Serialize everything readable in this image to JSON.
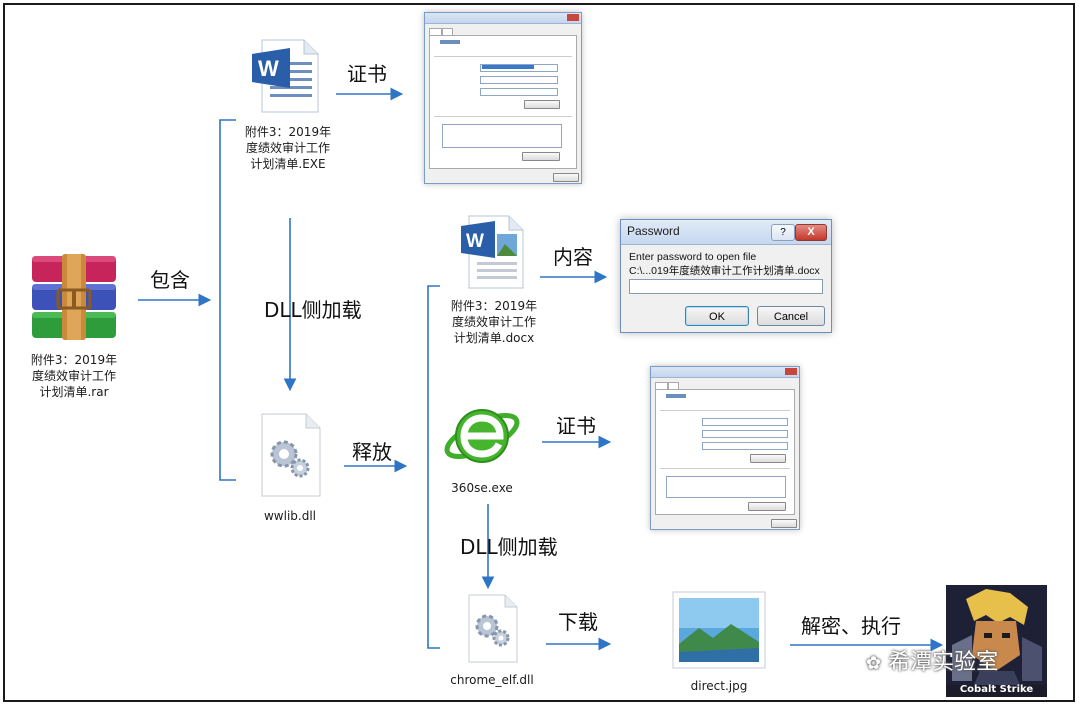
{
  "nodes": {
    "rar": {
      "caption": "附件3：2019年\n度绩效审计工作\n计划清单.rar",
      "icon": "winrar-archive-icon"
    },
    "exe": {
      "caption": "附件3：2019年\n度绩效审计工作\n计划清单.EXE",
      "icon": "word-document-icon"
    },
    "wwlib": {
      "caption": "wwlib.dll",
      "icon": "dll-gear-file-icon"
    },
    "docx": {
      "caption": "附件3：2019年\n度绩效审计工作\n计划清单.docx",
      "icon": "word-document-icon"
    },
    "se360": {
      "caption": "360se.exe",
      "icon": "360-browser-icon"
    },
    "chrome_elf": {
      "caption": "chrome_elf.dll",
      "icon": "dll-gear-file-icon"
    },
    "direct": {
      "caption": "direct.jpg",
      "icon": "image-file-icon"
    },
    "cobalt": {
      "caption": "Cobalt Strike",
      "icon": "cobalt-strike-logo"
    }
  },
  "edges": {
    "contains": "包含",
    "cert1": "证书",
    "dll_side1": "DLL侧加载",
    "release": "释放",
    "content": "内容",
    "cert2": "证书",
    "dll_side2": "DLL侧加载",
    "download": "下载",
    "decrypt_exec": "解密、执行"
  },
  "password_dialog": {
    "title": "Password",
    "help": "?",
    "close": "X",
    "message_line1": "Enter password to open file",
    "message_line2": "C:\\...019年度绩效审计工作计划清单.docx",
    "ok": "OK",
    "cancel": "Cancel"
  },
  "watermark": "希潭实验室",
  "colors": {
    "arrow": "#2f75c6",
    "frame": "#1a1a1a"
  }
}
